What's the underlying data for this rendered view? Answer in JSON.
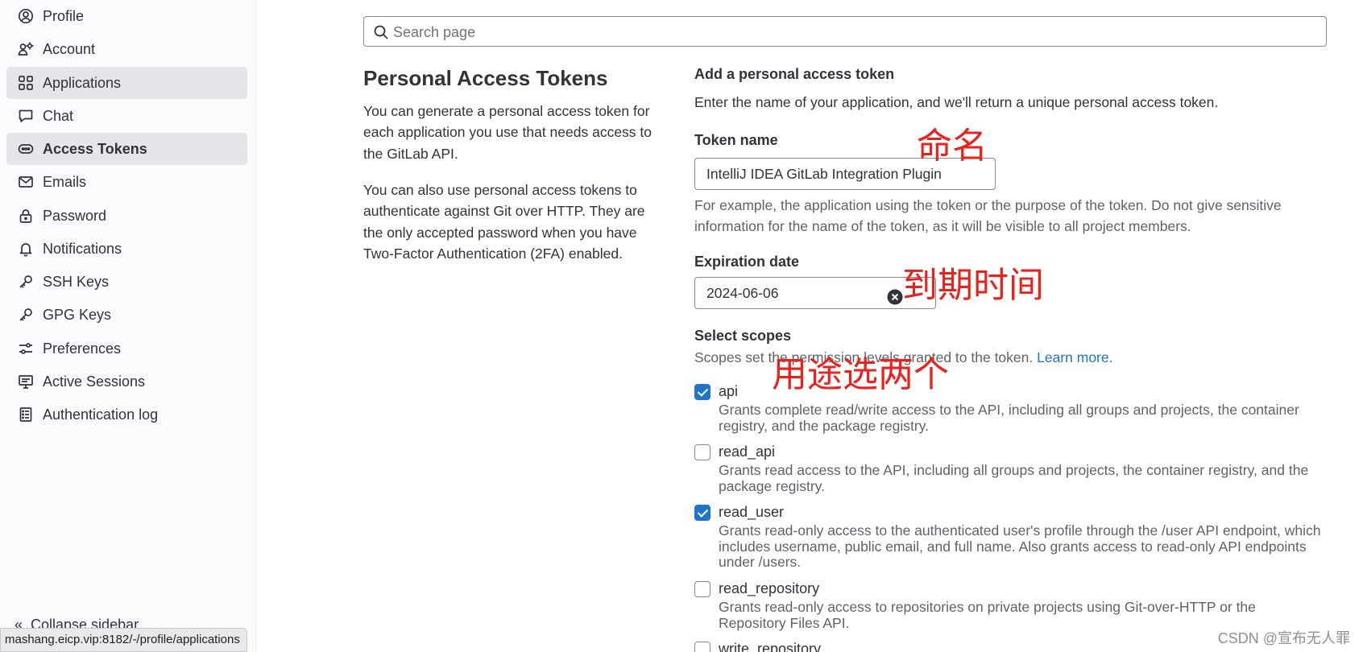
{
  "sidebar": {
    "items": [
      {
        "label": "Profile",
        "icon": "user-icon"
      },
      {
        "label": "Account",
        "icon": "account-icon"
      },
      {
        "label": "Applications",
        "icon": "applications-icon"
      },
      {
        "label": "Chat",
        "icon": "chat-icon"
      },
      {
        "label": "Access Tokens",
        "icon": "token-icon"
      },
      {
        "label": "Emails",
        "icon": "mail-icon"
      },
      {
        "label": "Password",
        "icon": "lock-icon"
      },
      {
        "label": "Notifications",
        "icon": "bell-icon"
      },
      {
        "label": "SSH Keys",
        "icon": "key-icon"
      },
      {
        "label": "GPG Keys",
        "icon": "key-icon"
      },
      {
        "label": "Preferences",
        "icon": "preferences-icon"
      },
      {
        "label": "Active Sessions",
        "icon": "monitor-icon"
      },
      {
        "label": "Authentication log",
        "icon": "log-icon"
      }
    ],
    "collapse_label": "Collapse sidebar",
    "status_url": "mashang.eicp.vip:8182/-/profile/applications"
  },
  "search": {
    "placeholder": "Search page"
  },
  "intro": {
    "title": "Personal Access Tokens",
    "para1": "You can generate a personal access token for each application you use that needs access to the GitLab API.",
    "para2": "You can also use personal access tokens to authenticate against Git over HTTP. They are the only accepted password when you have Two-Factor Authentication (2FA) enabled."
  },
  "form": {
    "heading": "Add a personal access token",
    "subheading": "Enter the name of your application, and we'll return a unique personal access token.",
    "token_name_label": "Token name",
    "token_name_value": "IntelliJ IDEA GitLab Integration Plugin",
    "token_name_help": "For example, the application using the token or the purpose of the token. Do not give sensitive information for the name of the token, as it will be visible to all project members.",
    "expiration_label": "Expiration date",
    "expiration_value": "2024-06-06",
    "scopes_label": "Select scopes",
    "scopes_help": "Scopes set the permission levels granted to the token.",
    "learn_more": "Learn more."
  },
  "scopes": [
    {
      "name": "api",
      "checked": true,
      "desc": "Grants complete read/write access to the API, including all groups and projects, the container registry, and the package registry."
    },
    {
      "name": "read_api",
      "checked": false,
      "desc": "Grants read access to the API, including all groups and projects, the container registry, and the package registry."
    },
    {
      "name": "read_user",
      "checked": true,
      "desc": "Grants read-only access to the authenticated user's profile through the /user API endpoint, which includes username, public email, and full name. Also grants access to read-only API endpoints under /users."
    },
    {
      "name": "read_repository",
      "checked": false,
      "desc": "Grants read-only access to repositories on private projects using Git-over-HTTP or the Repository Files API."
    },
    {
      "name": "write_repository",
      "checked": false,
      "desc": ""
    }
  ],
  "annotations": {
    "name": "命名",
    "expiry": "到期时间",
    "scopes": "用途选两个",
    "color": "#e8231d"
  },
  "watermark": "CSDN @宣布无人罪",
  "colors": {
    "accent": "#1f75cb",
    "active_bg": "#e6e5ea"
  }
}
